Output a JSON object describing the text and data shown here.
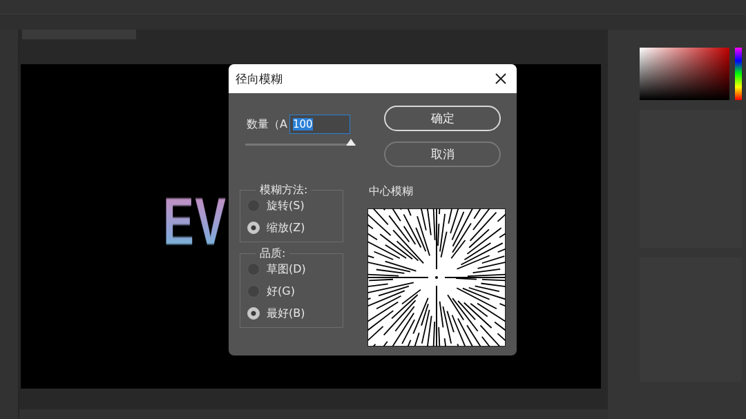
{
  "canvas": {
    "text": "EV"
  },
  "dialog": {
    "title": "径向模糊",
    "amount": {
      "label": "数量（A",
      "value": "100",
      "level": 1
    },
    "buttons": [
      {
        "label": "确定",
        "default": true
      },
      {
        "label": "取消",
        "default": false
      }
    ],
    "groups": [
      {
        "title": "模糊方法:",
        "options": [
          {
            "label": "旋转(S)",
            "selected": false
          },
          {
            "label": "缩放(Z)",
            "selected": true
          }
        ]
      },
      {
        "title": "品质:",
        "options": [
          {
            "label": "草图(D)",
            "selected": false
          },
          {
            "label": "好(G)",
            "selected": false
          },
          {
            "label": "最好(B)",
            "selected": true
          }
        ]
      }
    ],
    "preview": {
      "title": "中心模糊"
    }
  }
}
